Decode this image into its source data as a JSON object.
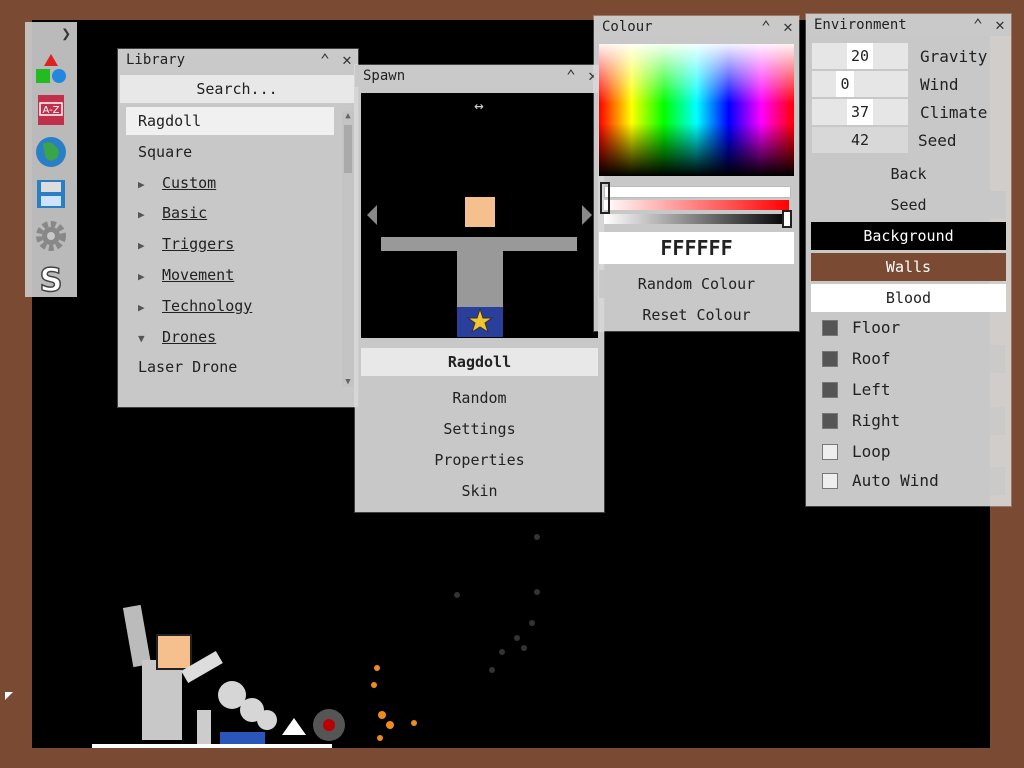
{
  "toolbar": {
    "expand_icon": "chevron-right-icon",
    "tools": [
      "shapes-icon",
      "a-z-book-icon",
      "globe-icon",
      "save-disk-icon",
      "gear-icon",
      "s-logo-icon"
    ]
  },
  "library": {
    "title": "Library",
    "search_label": "Search...",
    "items": [
      {
        "label": "Ragdoll",
        "type": "item",
        "selected": true
      },
      {
        "label": "Square",
        "type": "item"
      },
      {
        "label": "Custom",
        "type": "folder"
      },
      {
        "label": "Basic",
        "type": "folder"
      },
      {
        "label": "Triggers",
        "type": "folder"
      },
      {
        "label": "Movement",
        "type": "folder"
      },
      {
        "label": "Technology",
        "type": "folder"
      },
      {
        "label": "Drones",
        "type": "folder-open"
      },
      {
        "label": "Laser Drone",
        "type": "item"
      }
    ]
  },
  "spawn": {
    "title": "Spawn",
    "selected_label": "Ragdoll",
    "buttons": [
      "Random",
      "Settings",
      "Properties",
      "Skin"
    ]
  },
  "colour": {
    "title": "Colour",
    "hex_value": "FFFFFF",
    "random_label": "Random Colour",
    "reset_label": "Reset Colour"
  },
  "environment": {
    "title": "Environment",
    "params": [
      {
        "value": "20",
        "label": "Gravity"
      },
      {
        "value": "0",
        "label": "Wind"
      },
      {
        "value": "37",
        "label": "Climate"
      },
      {
        "value": "42",
        "label": "Seed"
      }
    ],
    "back_label": "Back",
    "seed_label": "Seed",
    "background_label": "Background",
    "walls_label": "Walls",
    "blood_label": "Blood",
    "colors": {
      "background": "#000000",
      "walls": "#7a4a33",
      "blood": "#ffffff"
    },
    "checks": [
      {
        "label": "Floor",
        "checked": true
      },
      {
        "label": "Roof",
        "checked": true
      },
      {
        "label": "Left",
        "checked": true
      },
      {
        "label": "Right",
        "checked": true
      },
      {
        "label": "Loop",
        "checked": false
      },
      {
        "label": "Auto Wind",
        "checked": false
      }
    ]
  }
}
